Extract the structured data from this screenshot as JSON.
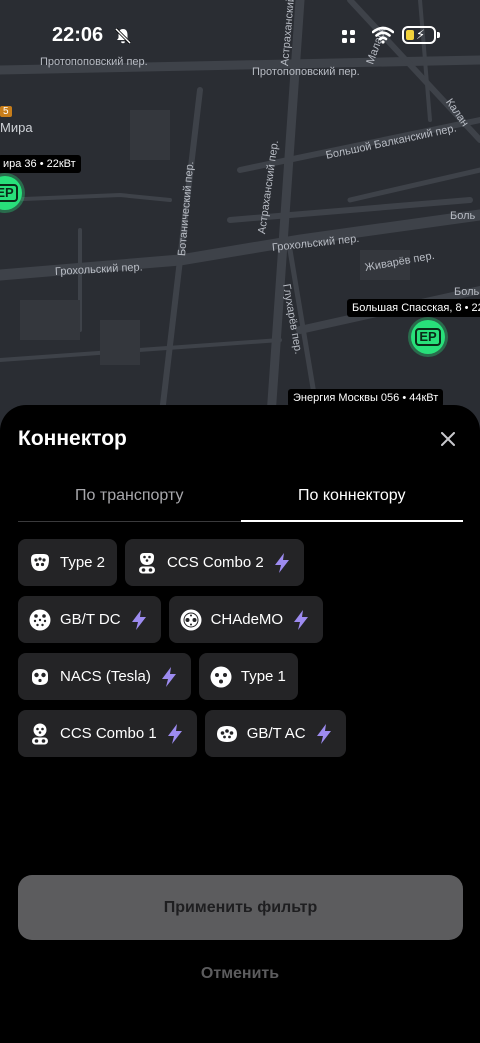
{
  "status_bar": {
    "time": "22:06"
  },
  "map": {
    "streets": [
      "Протопоповский пер.",
      "Протопоповский пер.",
      "Астраханский пер.",
      "Большой Балканский пер.",
      "Ботанический пер.",
      "Астраханский пер.",
      "Грохольский пер.",
      "Грохольский пер.",
      "Глухарёв пер.",
      "Живарёв пер.",
      "Калан",
      "Боль",
      "Боль",
      "Маласк",
      "Мира",
      "5"
    ],
    "stations": [
      {
        "label": "ира 36 • 22кВт",
        "pin": "ЕР"
      },
      {
        "label": "Большая Спасская, 8 • 22",
        "pin": "ЕР"
      },
      {
        "label": "Энергия Москвы 056 • 44кВт"
      }
    ]
  },
  "sheet": {
    "title": "Коннектор",
    "tabs": [
      {
        "label": "По транспорту",
        "active": false
      },
      {
        "label": "По коннектору",
        "active": true
      }
    ],
    "connectors": [
      {
        "label": "Type 2",
        "fast": false
      },
      {
        "label": "CCS Combo 2",
        "fast": true
      },
      {
        "label": "GB/T DC",
        "fast": true
      },
      {
        "label": "CHAdeMO",
        "fast": true
      },
      {
        "label": "NACS (Tesla)",
        "fast": true
      },
      {
        "label": "Type 1",
        "fast": false
      },
      {
        "label": "CCS Combo 1",
        "fast": true
      },
      {
        "label": "GB/T AC",
        "fast": true
      }
    ],
    "apply_label": "Применить фильтр",
    "cancel_label": "Отменить"
  },
  "colors": {
    "pin": "#28e07a",
    "bolt": "#9d8bf0",
    "chip_bg": "#242426",
    "apply_bg": "#5c5c5e"
  }
}
